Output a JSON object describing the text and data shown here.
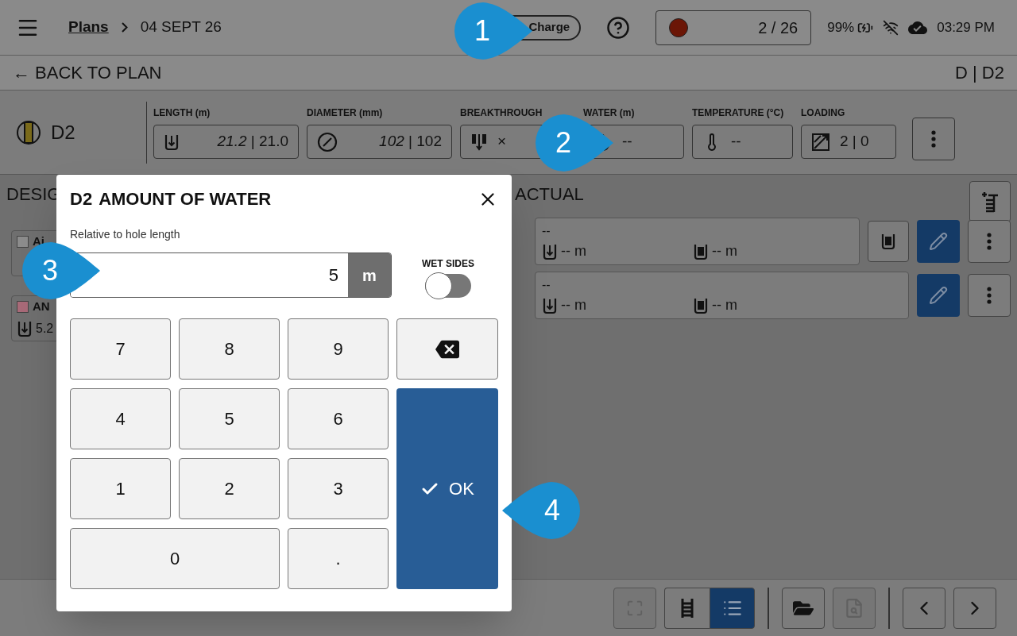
{
  "header": {
    "breadcrumb": [
      {
        "label": "Plans",
        "kind": "link"
      },
      {
        "label": "04 SEPT 26",
        "kind": "text"
      }
    ],
    "charge_button": "Charge",
    "counter": "2 / 26",
    "battery": "99%",
    "time": "03:29 PM"
  },
  "subheader": {
    "back": "← BACK TO PLAN",
    "location": "D | D2"
  },
  "hole": {
    "name": "D2",
    "params": [
      {
        "label": "LENGTH (m)",
        "kind": "length",
        "value": "*21.2* | 21.0"
      },
      {
        "label": "DIAMETER (mm)",
        "kind": "diameter",
        "value": "*102* | 102"
      },
      {
        "label": "BREAKTHROUGH",
        "kind": "breakthrough",
        "value": "×"
      },
      {
        "label": "WATER (m)",
        "kind": "water",
        "value": "--"
      },
      {
        "label": "TEMPERATURE (°C)",
        "kind": "temperature",
        "value": "--"
      },
      {
        "label": "LOADING",
        "kind": "loading",
        "value": "2 | 0"
      }
    ]
  },
  "design": {
    "title": "DESIG",
    "rows": [
      {
        "label": "Ai",
        "color": "#8c8c8c"
      },
      {
        "label": "AN",
        "color": "#a86a78",
        "depth": "5.2"
      }
    ]
  },
  "actual": {
    "title": "ACTUAL",
    "rows": [
      {
        "title": "--",
        "depth": "-- m",
        "water": "-- m",
        "charge_button": true
      },
      {
        "title": "--",
        "depth": "-- m",
        "water": "-- m",
        "charge_button": false
      }
    ]
  },
  "toolbar": [
    {
      "kind": "expand",
      "disabled": true
    },
    {
      "kind": "ladder",
      "selected": false
    },
    {
      "kind": "list",
      "selected": true
    },
    {
      "kind": "folder",
      "disabled": false
    },
    {
      "kind": "file",
      "disabled": true
    },
    {
      "kind": "prev",
      "disabled": false
    },
    {
      "kind": "next",
      "disabled": false
    }
  ],
  "dialog": {
    "hole": "D2",
    "title": "AMOUNT OF WATER",
    "field_label": "Relative to hole length",
    "value": "5",
    "unit": "m",
    "wet_sides": {
      "label": "WET SIDES",
      "on": false
    },
    "keys": [
      {
        "kind": "digit",
        "label": "7"
      },
      {
        "kind": "digit",
        "label": "8"
      },
      {
        "kind": "digit",
        "label": "9"
      },
      {
        "kind": "backspace"
      },
      {
        "kind": "digit",
        "label": "4"
      },
      {
        "kind": "digit",
        "label": "5"
      },
      {
        "kind": "digit",
        "label": "6"
      },
      {
        "kind": "digit",
        "label": "1"
      },
      {
        "kind": "digit",
        "label": "2"
      },
      {
        "kind": "digit",
        "label": "3"
      },
      {
        "kind": "wide",
        "label": "0"
      },
      {
        "kind": "digit",
        "label": "."
      },
      {
        "kind": "ok",
        "label": "OK"
      }
    ]
  },
  "callouts": [
    {
      "label": "1"
    },
    {
      "label": "2"
    },
    {
      "label": "3"
    },
    {
      "label": "4"
    }
  ]
}
